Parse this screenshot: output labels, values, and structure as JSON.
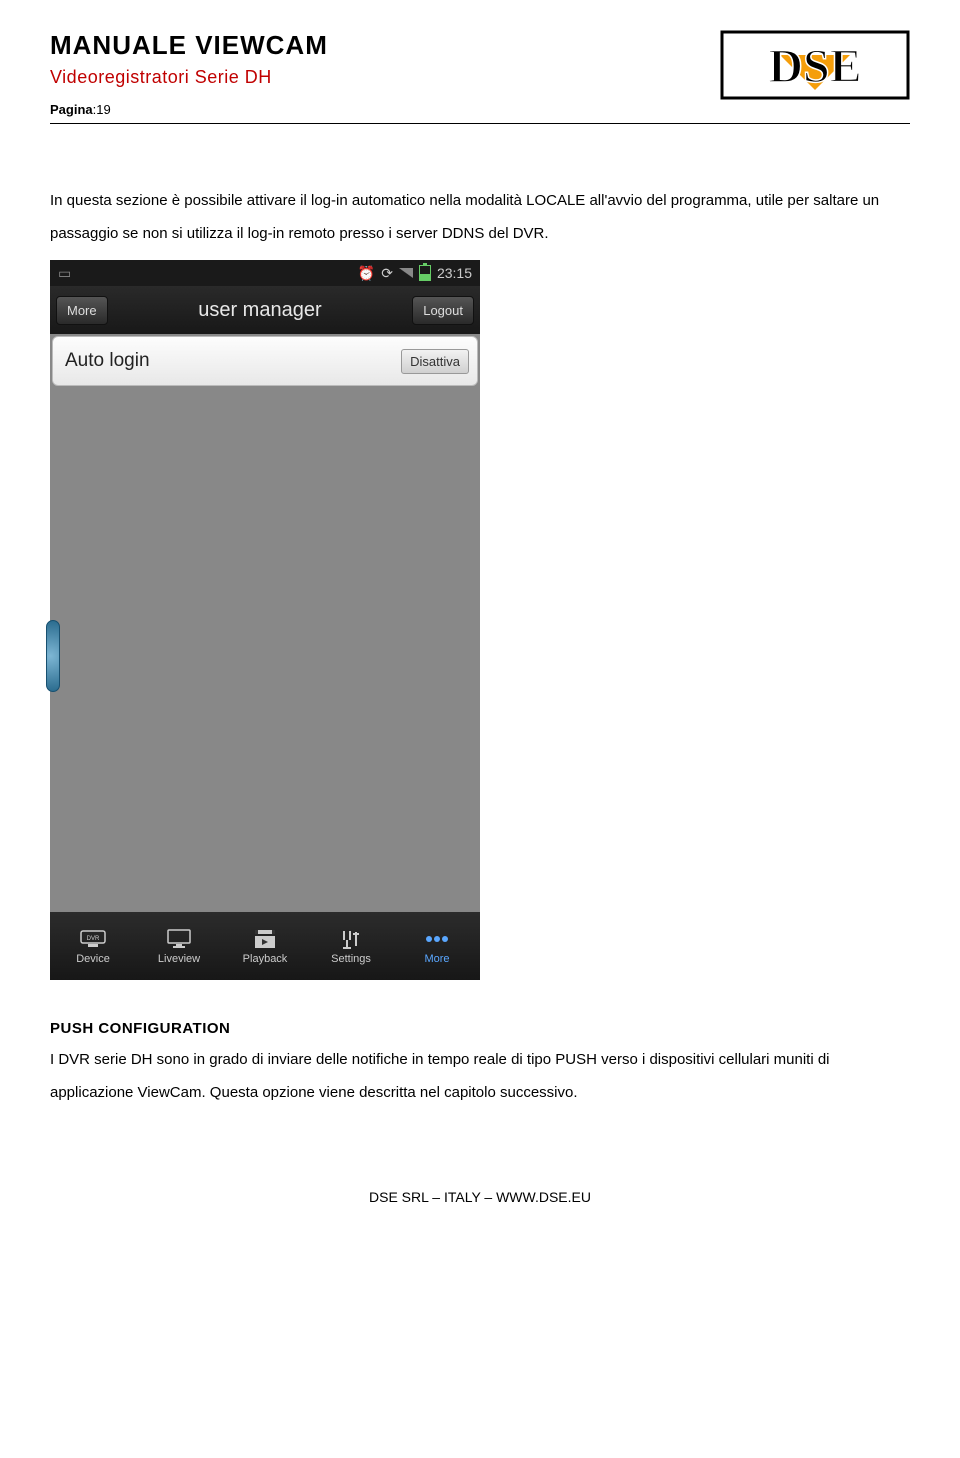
{
  "header": {
    "title": "MANUALE VIEWCAM",
    "subtitle": "Videoregistratori Serie DH",
    "page_label": "Pagina",
    "page_num": ":19"
  },
  "logo": {
    "text": "DSE"
  },
  "paragraph1": "In questa sezione è possibile attivare il log-in automatico nella modalità LOCALE all'avvio del programma, utile per saltare un passaggio se non si utilizza il log-in remoto presso i server DDNS del DVR.",
  "phone": {
    "status_time": "23:15",
    "topbar": {
      "left_btn": "More",
      "title": "user manager",
      "right_btn": "Logout"
    },
    "row": {
      "label": "Auto login",
      "btn": "Disattiva"
    },
    "tabs": [
      {
        "label": "Device"
      },
      {
        "label": "Liveview"
      },
      {
        "label": "Playback"
      },
      {
        "label": "Settings"
      },
      {
        "label": "More"
      }
    ]
  },
  "section2": {
    "heading": "PUSH CONFIGURATION",
    "body": "I DVR serie DH sono in grado di inviare delle notifiche in tempo reale di tipo PUSH verso i dispositivi cellulari muniti di applicazione ViewCam. Questa opzione viene descritta nel capitolo successivo."
  },
  "footer": "DSE SRL – ITALY – WWW.DSE.EU"
}
